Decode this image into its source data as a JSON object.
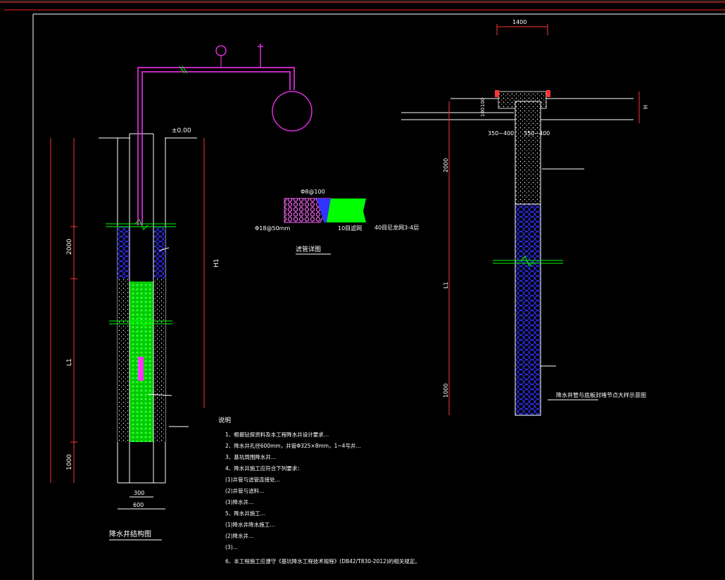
{
  "colors": {
    "background": "#000000",
    "frame": "#ffffff",
    "top_border": "#ff2020",
    "pipe": "#ff33ff",
    "dimension": "#ff3333",
    "filter_pack": "#3333ff",
    "gravel": "#00ff00",
    "note_text": "#ffff66"
  },
  "left_well": {
    "elev_label": "±0.00",
    "dim_top": "2000",
    "dim_mid": "L1",
    "dim_bottom": "1000",
    "dim_total": "H1",
    "width_inner": "300",
    "width_outer": "600",
    "title": "降水井结构图"
  },
  "filter_detail": {
    "label_top": "Φ8@100",
    "label_left": "Φ18@50mm",
    "label_mid": "10目滤网",
    "label_right": "40目尼龙网3-4层",
    "title": "滤管详图"
  },
  "right_well": {
    "dim_top_width": "1400",
    "dim_left_bottom": "350~400",
    "dim_right_bottom": "350~400",
    "dim_100a": "100",
    "dim_100b": "100",
    "dim_h": "H",
    "dim_2000": "2000",
    "dim_l1": "L1",
    "dim_1000": "1000",
    "title": "降水井管与底板封堵节点大样示意图"
  },
  "notes": {
    "heading": "说明",
    "lines": [
      "1、根据钻探资料及本工程降水井设计要求…",
      "2、降水井孔径600mm，井管Φ325×8mm，1~4号井…",
      "3、基坑周围降水井…",
      "4、降水井施工应符合下列要求：",
      "(1)井管与滤管连接处…",
      "(2)井管与滤料…",
      "(3)降水井…",
      "5、降水井施工…",
      "(1)降水井降水施工…",
      "(2)降水井…",
      "(3)…",
      "6、本工程施工应遵守《基坑降水工程技术规程》(DB42/T830-2012)的相关规定。"
    ]
  }
}
